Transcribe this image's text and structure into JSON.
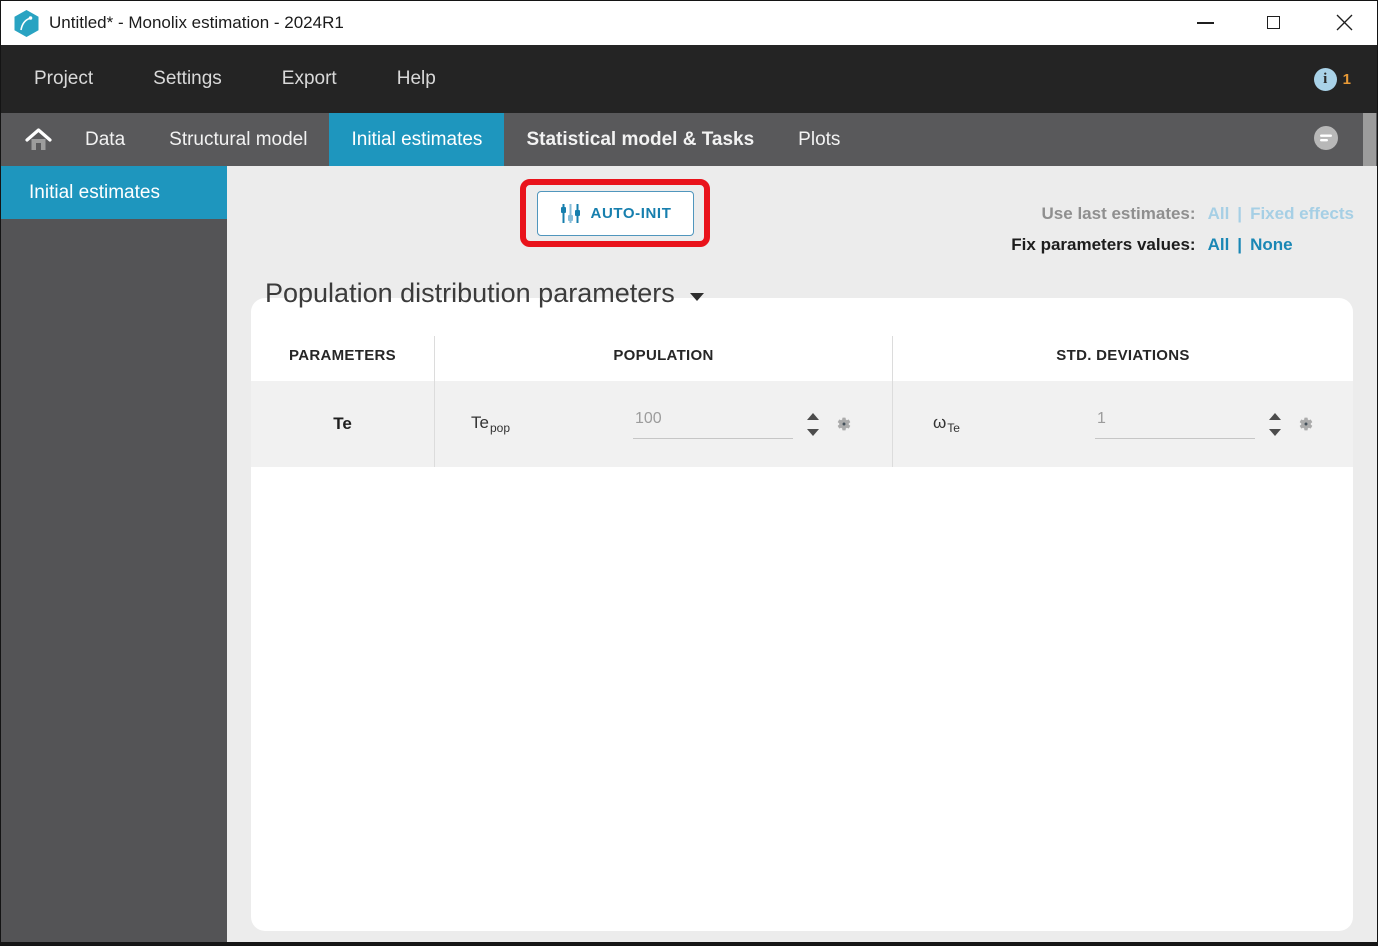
{
  "window": {
    "title": "Untitled* - Monolix estimation - 2024R1"
  },
  "menubar": {
    "items": [
      "Project",
      "Settings",
      "Export",
      "Help"
    ],
    "info_badge": "1"
  },
  "tabbar": {
    "tabs": [
      "Data",
      "Structural model",
      "Initial estimates",
      "Statistical model & Tasks",
      "Plots"
    ],
    "active_tab": "Initial estimates"
  },
  "sidebar": {
    "items": [
      "Initial estimates"
    ],
    "active_item": "Initial estimates"
  },
  "toolbar": {
    "autoinit_label": "AUTO-INIT",
    "use_last_label": "Use last estimates:",
    "use_last_options": [
      "All",
      "Fixed effects"
    ],
    "fix_values_label": "Fix parameters values:",
    "fix_values_options": [
      "All",
      "None"
    ],
    "separator": "|"
  },
  "section": {
    "title": "Population distribution parameters"
  },
  "table": {
    "headers": [
      "PARAMETERS",
      "POPULATION",
      "STD. DEVIATIONS"
    ],
    "rows": [
      {
        "parameter": "Te",
        "pop_base": "Te",
        "pop_sub": "pop",
        "pop_value": "100",
        "std_base": "ω",
        "std_sub": "Te",
        "std_value": "1"
      }
    ]
  },
  "colors": {
    "accent_blue": "#1e96be",
    "link_blue": "#1a87b5",
    "disabled_link_blue": "#a6cfe5",
    "annotation_red": "#e9131b",
    "menubar_bg": "#242424",
    "tabbar_bg": "#59595b"
  }
}
